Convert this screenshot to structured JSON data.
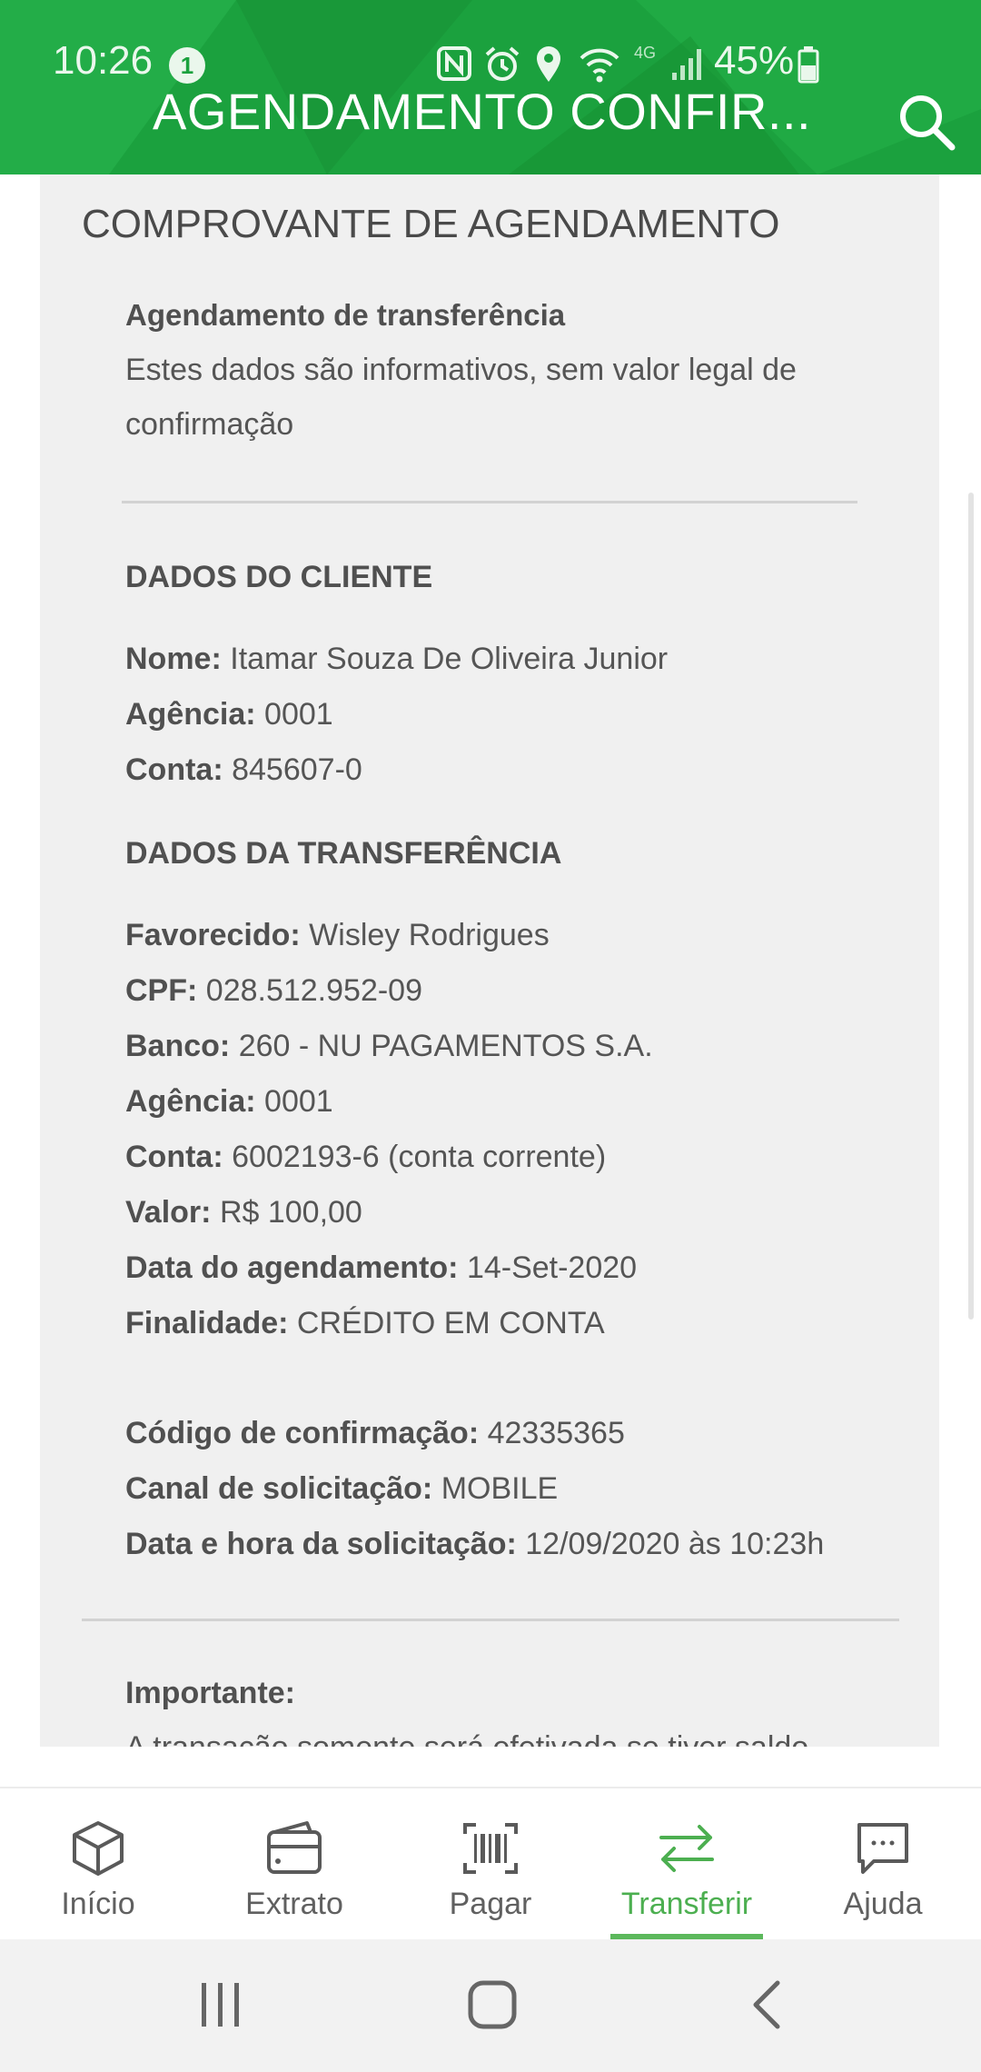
{
  "status_bar": {
    "time": "10:26",
    "notification_count": "1",
    "network": "4G",
    "battery": "45%"
  },
  "header": {
    "title": "AGENDAMENTO CONFIR...",
    "search_icon": "search-icon",
    "color": "#1ba13e"
  },
  "receipt": {
    "title": "COMPROVANTE DE AGENDAMENTO",
    "subtitle": "Agendamento de transferência",
    "disclaimer_line1": "Estes dados são informativos, sem valor legal de",
    "disclaimer_line2": "confirmação",
    "client_section": {
      "heading": "DADOS DO CLIENTE",
      "name_label": "Nome:",
      "name_value": "Itamar Souza De Oliveira Junior",
      "agency_label": "Agência:",
      "agency_value": "0001",
      "account_label": "Conta:",
      "account_value": "845607-0"
    },
    "transfer_section": {
      "heading": "DADOS DA TRANSFERÊNCIA",
      "beneficiary_label": "Favorecido:",
      "beneficiary_value": "Wisley Rodrigues",
      "cpf_label": "CPF:",
      "cpf_value": "028.512.952-09",
      "bank_label": "Banco:",
      "bank_value": "260 - NU PAGAMENTOS S.A.",
      "agency_label": "Agência:",
      "agency_value": "0001",
      "account_label": "Conta:",
      "account_value": "6002193-6 (conta corrente)",
      "amount_label": "Valor:",
      "amount_value": "R$ 100,00",
      "date_label": "Data do agendamento:",
      "date_value": "14-Set-2020",
      "purpose_label": "Finalidade:",
      "purpose_value": "CRÉDITO EM CONTA"
    },
    "confirmation": {
      "code_label": "Código de confirmação:",
      "code_value": "42335365",
      "channel_label": "Canal de solicitação:",
      "channel_value": "MOBILE",
      "datetime_label": "Data e hora da solicitação:",
      "datetime_value": "12/09/2020 às 10:23h"
    },
    "important_label": "Importante:",
    "important_text": "A transação somente será efetivada se tiver saldo"
  },
  "bottom_nav": {
    "items": [
      {
        "label": "Início",
        "icon": "box-icon"
      },
      {
        "label": "Extrato",
        "icon": "wallet-icon"
      },
      {
        "label": "Pagar",
        "icon": "barcode-icon"
      },
      {
        "label": "Transferir",
        "icon": "transfer-arrows-icon"
      },
      {
        "label": "Ajuda",
        "icon": "chat-icon"
      }
    ],
    "active_index": 3,
    "active_color": "#4caf50"
  },
  "system_nav": {
    "recents_icon": "recents-icon",
    "home_icon": "home-icon",
    "back_icon": "back-icon"
  }
}
